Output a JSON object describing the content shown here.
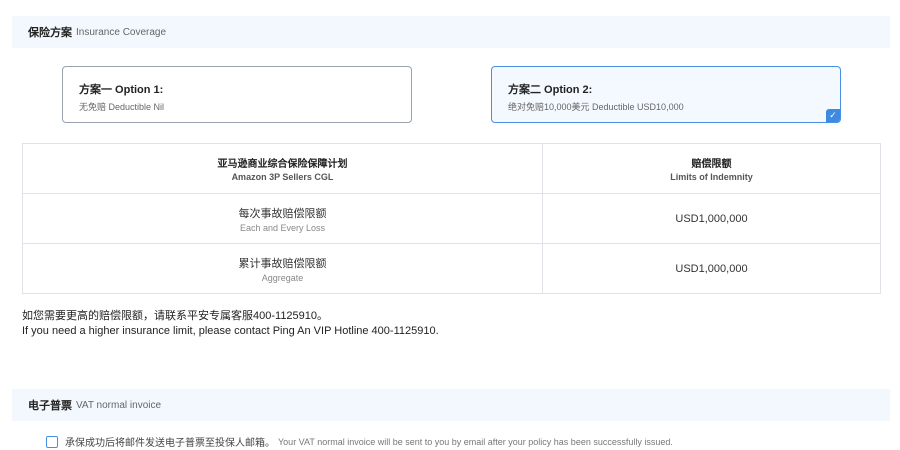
{
  "coverage_section": {
    "title_zh": "保险方案",
    "title_en": "Insurance Coverage"
  },
  "options": [
    {
      "title": "方案一 Option 1:",
      "subtitle": "无免赔 Deductible Nil",
      "selected": false
    },
    {
      "title": "方案二 Option 2:",
      "subtitle": "绝对免赔10,000美元 Deductible USD10,000",
      "selected": true,
      "check_icon": "check-icon"
    }
  ],
  "table": {
    "header": {
      "plan_zh": "亚马逊商业综合保险保障计划",
      "plan_en": "Amazon 3P Sellers CGL",
      "limit_zh": "赔偿限额",
      "limit_en": "Limits of Indemnity"
    },
    "rows": [
      {
        "label_zh": "每次事故赔偿限额",
        "label_en": "Each and Every Loss",
        "value": "USD1,000,000"
      },
      {
        "label_zh": "累计事故赔偿限额",
        "label_en": "Aggregate",
        "value": "USD1,000,000"
      }
    ]
  },
  "note": {
    "zh": "如您需要更高的赔偿限额，请联系平安专属客服400-1125910。",
    "en": "If you need a higher insurance limit, please contact Ping An VIP Hotline 400-1125910."
  },
  "invoice_section": {
    "title_zh": "电子普票",
    "title_en": "VAT normal invoice"
  },
  "invoice_option": {
    "zh": "承保成功后将邮件发送电子普票至投保人邮箱。",
    "en": "Your VAT normal invoice will be sent to you by email after your policy has been successfully issued.",
    "checked": false
  },
  "colors": {
    "accent": "#4a90e2",
    "header_bg": "#f2f8fd",
    "border": "#dfe3e8"
  }
}
